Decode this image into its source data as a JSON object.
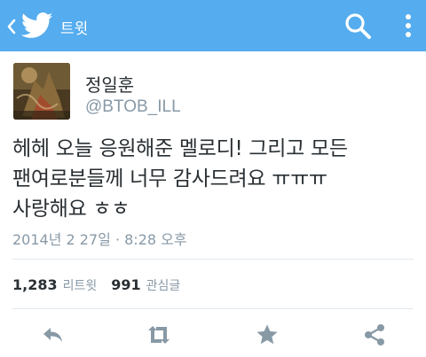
{
  "colors": {
    "accent": "#55acee",
    "text": "#292f33",
    "secondary_text": "#8899a6",
    "divider": "#e1e8ed",
    "action_icon": "#8899a6"
  },
  "appbar": {
    "back_icon": "chevron-left-icon",
    "logo_icon": "twitter-bird-icon",
    "title": "트윗",
    "search_icon": "search-icon",
    "overflow_icon": "more-vertical-icon"
  },
  "tweet": {
    "display_name": "정일훈",
    "handle": "@BTOB_ILL",
    "text": "헤헤 오늘 응원해준 멜로디! 그리고 모든\n팬여로분들께 너무 감사드려요 ㅠㅠㅠ\n사랑해요 ㅎㅎ",
    "timestamp": "2014년 2 27일 · 8:28 오후"
  },
  "stats": {
    "retweets_count": "1,283",
    "retweets_label": "리트윗",
    "favorites_count": "991",
    "favorites_label": "관심글"
  },
  "actions": {
    "reply_icon": "reply-icon",
    "retweet_icon": "retweet-icon",
    "favorite_icon": "star-icon",
    "share_icon": "share-icon"
  }
}
